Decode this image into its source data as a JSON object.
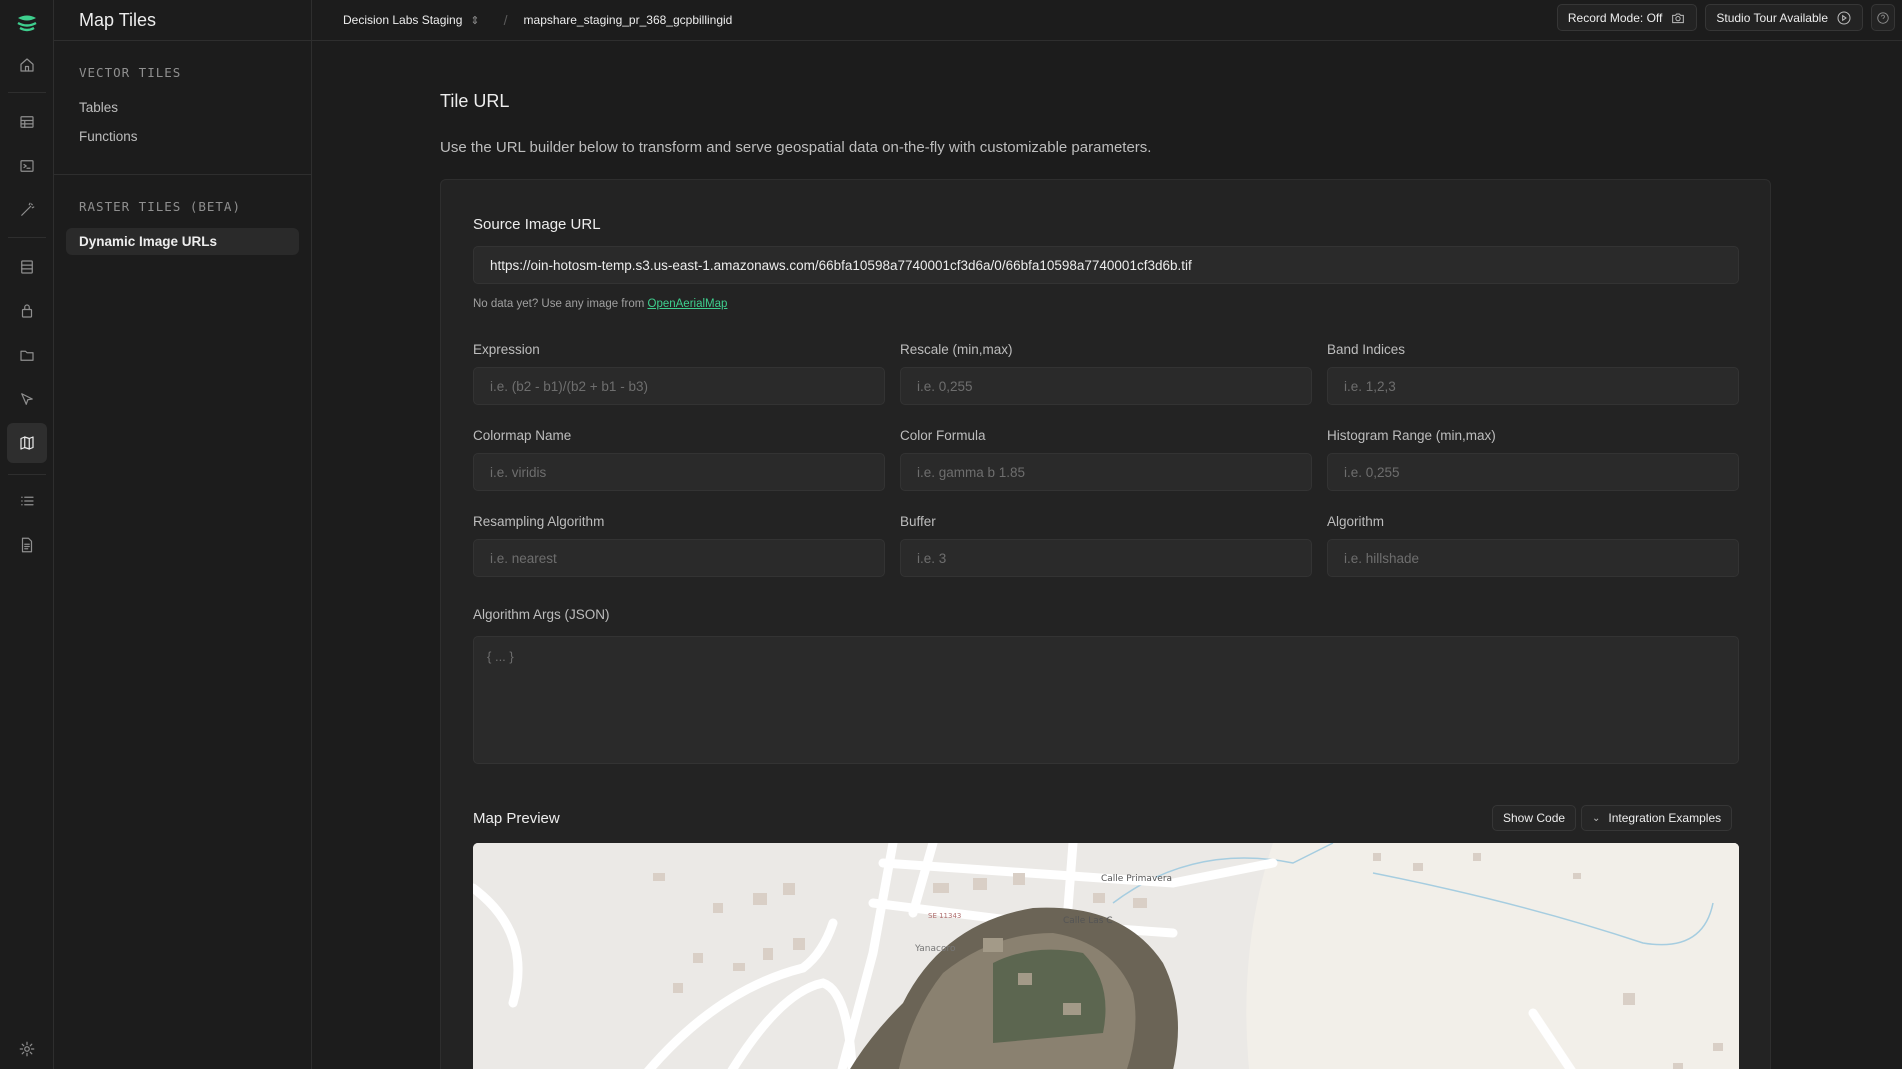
{
  "app": {
    "title": "Map Tiles"
  },
  "topbar": {
    "project": "Decision Labs Staging",
    "branch": "mapshare_staging_pr_368_gcpbillingid",
    "record_mode": "Record Mode: Off",
    "studio_tour": "Studio Tour Available"
  },
  "sidebar": {
    "vector_label": "VECTOR TILES",
    "vector_items": [
      {
        "label": "Tables"
      },
      {
        "label": "Functions"
      }
    ],
    "raster_label": "RASTER TILES (BETA)",
    "raster_items": [
      {
        "label": "Dynamic Image URLs"
      }
    ]
  },
  "page": {
    "title": "Tile URL",
    "description": "Use the URL builder below to transform and serve geospatial data on-the-fly with customizable parameters."
  },
  "form": {
    "source_label": "Source Image URL",
    "source_value": "https://oin-hotosm-temp.s3.us-east-1.amazonaws.com/66bfa10598a7740001cf3d6a/0/66bfa10598a7740001cf3d6b.tif",
    "hint_prefix": "No data yet? Use any image from ",
    "hint_link": "OpenAerialMap",
    "fields": [
      {
        "label": "Expression",
        "placeholder": "i.e. (b2 - b1)/(b2 + b1 - b3)"
      },
      {
        "label": "Rescale (min,max)",
        "placeholder": "i.e. 0,255"
      },
      {
        "label": "Band Indices",
        "placeholder": "i.e. 1,2,3"
      },
      {
        "label": "Colormap Name",
        "placeholder": "i.e. viridis"
      },
      {
        "label": "Color Formula",
        "placeholder": "i.e. gamma b 1.85"
      },
      {
        "label": "Histogram Range (min,max)",
        "placeholder": "i.e. 0,255"
      },
      {
        "label": "Resampling Algorithm",
        "placeholder": "i.e. nearest"
      },
      {
        "label": "Buffer",
        "placeholder": "i.e. 3"
      },
      {
        "label": "Algorithm",
        "placeholder": "i.e. hillshade"
      }
    ],
    "args_label": "Algorithm Args (JSON)",
    "args_placeholder": "{ ... }"
  },
  "preview": {
    "title": "Map Preview",
    "show_code": "Show Code",
    "integration": "Integration Examples",
    "map_labels": {
      "street1": "Calle Primavera",
      "street2": "Calle Las C",
      "place": "Yanacoro",
      "road": "SE 11343"
    }
  },
  "colors": {
    "accent": "#3ecf8e",
    "background": "#1c1c1c",
    "card": "#232323"
  }
}
